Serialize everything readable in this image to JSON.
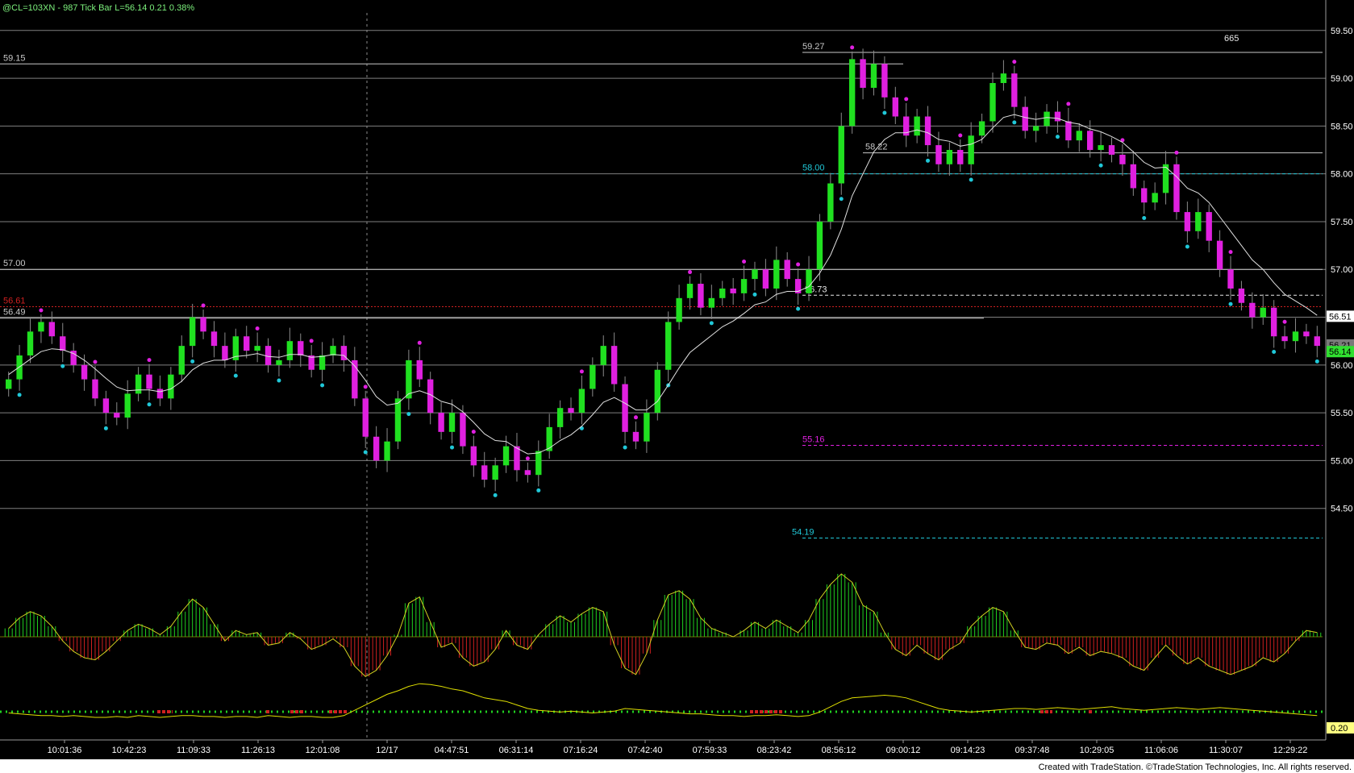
{
  "header": {
    "symbol": "@CL=103XN",
    "bar_type": "987 Tick Bar",
    "last_label": "L=56.14",
    "change": "0.21",
    "change_pct": "0.38%"
  },
  "footer": {
    "credit": "Created with TradeStation. ©TradeStation Technologies, Inc. All rights reserved."
  },
  "colors": {
    "background": "#000000",
    "up_bar": "#20e020",
    "down_bar": "#e020e0",
    "ma_line": "#e0e0e0",
    "cyan": "#20c8d8",
    "magenta": "#e020e0",
    "red": "#d02020",
    "green": "#20d020",
    "yellow": "#e0e000",
    "grid": "#7f7f7f"
  },
  "chart_data": {
    "type": "candlestick",
    "price_axis": {
      "ylim": [
        54.0,
        59.65
      ],
      "ticks": [
        "59.50",
        "59.00",
        "58.50",
        "58.00",
        "57.50",
        "57.00",
        "56.50",
        "56.00",
        "55.50",
        "55.00",
        "54.50"
      ],
      "last_price_label": "56.14",
      "current_label": "56.51",
      "partial_label": "56.21",
      "volume_count": "665"
    },
    "time_ticks": [
      "10:01:36",
      "10:42:23",
      "11:09:33",
      "11:26:13",
      "12:01:08",
      "12/17",
      "04:47:51",
      "06:31:14",
      "07:16:24",
      "07:42:40",
      "07:59:33",
      "08:23:42",
      "08:56:12",
      "09:00:12",
      "09:14:23",
      "09:37:48",
      "10:29:05",
      "11:06:06",
      "11:30:07",
      "12:29:22"
    ],
    "closes": [
      55.85,
      56.1,
      56.35,
      56.45,
      56.3,
      56.15,
      56.0,
      55.85,
      55.65,
      55.5,
      55.45,
      55.7,
      55.9,
      55.75,
      55.65,
      55.9,
      56.2,
      56.5,
      56.35,
      56.2,
      56.05,
      56.3,
      56.15,
      56.2,
      56.0,
      56.05,
      56.25,
      56.1,
      55.95,
      56.1,
      56.2,
      56.05,
      55.65,
      55.25,
      55.0,
      55.2,
      55.65,
      56.05,
      55.85,
      55.5,
      55.3,
      55.5,
      55.15,
      54.95,
      54.8,
      54.95,
      55.15,
      54.9,
      54.85,
      55.1,
      55.35,
      55.55,
      55.5,
      55.75,
      56.0,
      56.2,
      55.8,
      55.3,
      55.2,
      55.5,
      55.95,
      56.45,
      56.7,
      56.85,
      56.6,
      56.7,
      56.8,
      56.75,
      56.9,
      57.0,
      56.8,
      57.1,
      56.9,
      56.75,
      57.0,
      57.5,
      57.9,
      58.5,
      59.2,
      58.9,
      59.15,
      58.8,
      58.6,
      58.4,
      58.6,
      58.3,
      58.1,
      58.25,
      58.1,
      58.4,
      58.55,
      58.95,
      59.05,
      58.7,
      58.45,
      58.5,
      58.65,
      58.55,
      58.35,
      58.45,
      58.25,
      58.3,
      58.2,
      58.1,
      57.85,
      57.7,
      57.8,
      58.1,
      57.6,
      57.4,
      57.6,
      57.3,
      57.0,
      56.8,
      56.65,
      56.5,
      56.6,
      56.3,
      56.25,
      56.35,
      56.3,
      56.2
    ],
    "moving_average": [
      55.9,
      55.98,
      56.06,
      56.14,
      56.17,
      56.16,
      56.12,
      56.05,
      55.96,
      55.86,
      55.77,
      55.73,
      55.74,
      55.74,
      55.72,
      55.75,
      55.83,
      55.95,
      56.02,
      56.05,
      56.05,
      56.09,
      56.1,
      56.12,
      56.09,
      56.08,
      56.11,
      56.11,
      56.08,
      56.09,
      56.11,
      56.1,
      55.99,
      55.84,
      55.67,
      55.58,
      55.6,
      55.7,
      55.73,
      55.69,
      55.62,
      55.59,
      55.51,
      55.4,
      55.28,
      55.21,
      55.2,
      55.13,
      55.07,
      55.08,
      55.13,
      55.21,
      55.27,
      55.36,
      55.48,
      55.61,
      55.66,
      55.6,
      55.53,
      55.53,
      55.62,
      55.79,
      55.97,
      56.13,
      56.22,
      56.31,
      56.4,
      56.46,
      56.54,
      56.63,
      56.66,
      56.74,
      56.77,
      56.77,
      56.82,
      56.96,
      57.15,
      57.42,
      57.77,
      58.0,
      58.23,
      58.36,
      58.43,
      58.43,
      58.46,
      58.43,
      58.36,
      58.34,
      58.29,
      58.31,
      58.36,
      58.48,
      58.59,
      58.62,
      58.59,
      58.57,
      58.59,
      58.58,
      58.54,
      58.52,
      58.47,
      58.44,
      58.39,
      58.33,
      58.23,
      58.12,
      58.06,
      58.07,
      57.97,
      57.85,
      57.8,
      57.7,
      57.55,
      57.4,
      57.25,
      57.1,
      57.0,
      56.86,
      56.74,
      56.67,
      56.6,
      56.52
    ],
    "price_levels": [
      {
        "label": "59.15",
        "value": 59.15,
        "style": "solid",
        "color": "#c8c8c8"
      },
      {
        "label": "57.00",
        "value": 57.0,
        "style": "solid",
        "color": "#c8c8c8"
      },
      {
        "label": "56.61",
        "value": 56.61,
        "style": "dotted",
        "color": "#d02020"
      },
      {
        "label": "56.49",
        "value": 56.49,
        "style": "solid",
        "color": "#c8c8c8"
      },
      {
        "label": "59.27",
        "value": 59.27,
        "style": "solid",
        "color": "#c8c8c8"
      },
      {
        "label": "58.22",
        "value": 58.22,
        "style": "solid",
        "color": "#c8c8c8"
      },
      {
        "label": "58.00",
        "value": 58.0,
        "style": "dashed",
        "color": "#20c8d8"
      },
      {
        "label": "56.73",
        "value": 56.73,
        "style": "dashed",
        "color": "#e8e8e8"
      },
      {
        "label": "55.16",
        "value": 55.16,
        "style": "dashed",
        "color": "#e020e0"
      },
      {
        "label": "54.19",
        "value": 54.19,
        "style": "dashed",
        "color": "#20c8d8"
      }
    ],
    "oscillator": [
      0.4,
      0.9,
      1.2,
      1.0,
      0.5,
      -0.2,
      -0.7,
      -1.0,
      -1.1,
      -0.7,
      -0.2,
      0.3,
      0.6,
      0.4,
      0.1,
      0.5,
      1.2,
      1.8,
      1.4,
      0.6,
      -0.2,
      0.3,
      0.1,
      0.2,
      -0.4,
      -0.3,
      0.2,
      -0.1,
      -0.6,
      -0.4,
      -0.1,
      -0.5,
      -1.4,
      -1.9,
      -1.6,
      -0.9,
      0.1,
      1.6,
      1.9,
      0.7,
      -0.5,
      -0.3,
      -1.0,
      -1.4,
      -1.2,
      -0.6,
      0.3,
      -0.4,
      -0.6,
      0.1,
      0.6,
      1.0,
      0.7,
      1.1,
      1.4,
      1.2,
      -0.4,
      -1.5,
      -1.8,
      -0.8,
      0.8,
      2.0,
      2.2,
      1.8,
      0.9,
      0.4,
      0.2,
      0.0,
      0.3,
      0.7,
      0.4,
      0.8,
      0.5,
      0.2,
      0.8,
      1.8,
      2.5,
      3.0,
      2.6,
      1.5,
      1.2,
      0.2,
      -0.6,
      -0.9,
      -0.4,
      -0.8,
      -1.1,
      -0.6,
      -0.3,
      0.5,
      1.0,
      1.4,
      1.2,
      0.3,
      -0.5,
      -0.6,
      -0.3,
      -0.4,
      -0.8,
      -0.5,
      -0.9,
      -0.7,
      -0.8,
      -1.0,
      -1.4,
      -1.6,
      -1.0,
      -0.4,
      -0.9,
      -1.3,
      -1.0,
      -1.4,
      -1.6,
      -1.8,
      -1.6,
      -1.4,
      -1.0,
      -1.2,
      -0.8,
      -0.2,
      0.3,
      0.2
    ],
    "volatility": [
      0.25,
      0.24,
      0.23,
      0.22,
      0.22,
      0.21,
      0.22,
      0.21,
      0.2,
      0.2,
      0.21,
      0.2,
      0.22,
      0.21,
      0.2,
      0.21,
      0.22,
      0.22,
      0.21,
      0.21,
      0.2,
      0.21,
      0.21,
      0.2,
      0.22,
      0.21,
      0.2,
      0.21,
      0.21,
      0.2,
      0.2,
      0.22,
      0.28,
      0.34,
      0.4,
      0.46,
      0.5,
      0.55,
      0.58,
      0.57,
      0.55,
      0.52,
      0.5,
      0.46,
      0.42,
      0.4,
      0.38,
      0.34,
      0.3,
      0.28,
      0.27,
      0.26,
      0.27,
      0.26,
      0.25,
      0.26,
      0.27,
      0.3,
      0.29,
      0.28,
      0.27,
      0.26,
      0.25,
      0.24,
      0.24,
      0.23,
      0.22,
      0.22,
      0.21,
      0.22,
      0.22,
      0.23,
      0.22,
      0.21,
      0.22,
      0.26,
      0.32,
      0.38,
      0.42,
      0.43,
      0.44,
      0.45,
      0.44,
      0.42,
      0.38,
      0.34,
      0.3,
      0.28,
      0.27,
      0.26,
      0.27,
      0.28,
      0.29,
      0.3,
      0.3,
      0.29,
      0.3,
      0.31,
      0.3,
      0.29,
      0.3,
      0.31,
      0.32,
      0.3,
      0.29,
      0.28,
      0.29,
      0.3,
      0.31,
      0.3,
      0.29,
      0.3,
      0.31,
      0.3,
      0.29,
      0.28,
      0.27,
      0.26,
      0.25,
      0.24,
      0.23,
      0.22
    ],
    "volatility_label": "0.20"
  }
}
